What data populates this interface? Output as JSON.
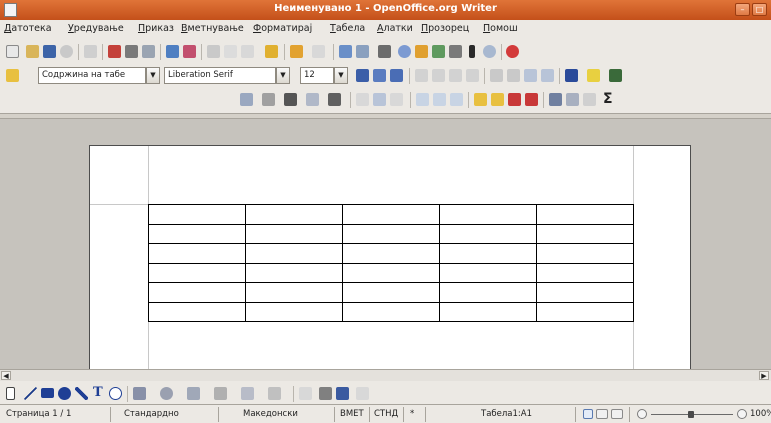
{
  "window": {
    "title": "Неименувано 1 - OpenOffice.org Writer"
  },
  "menu": {
    "items": [
      {
        "first": "Д",
        "rest": "атотека"
      },
      {
        "first": "У",
        "rest": "редување"
      },
      {
        "first": "П",
        "rest": "риказ"
      },
      {
        "first": "В",
        "rest": "метнување"
      },
      {
        "first": "Ф",
        "rest": "орматирај"
      },
      {
        "first": "Т",
        "rest": "абела"
      },
      {
        "first": "А",
        "rest": "латки"
      },
      {
        "first": "П",
        "rest": "розорец"
      },
      {
        "first": "П",
        "rest": "омош"
      }
    ]
  },
  "formatting": {
    "paragraph_style": "Содржина на табе",
    "font_name": "Liberation Serif",
    "font_size": "12"
  },
  "table_toolbar": {
    "sum_symbol": "Σ"
  },
  "document": {
    "table": {
      "rows": 6,
      "cols": 5
    }
  },
  "status": {
    "page": "Страница 1 / 1",
    "page_style": "Стандардно",
    "language": "Македонски",
    "insert_mode": "ВМЕТ",
    "selection_mode": "СТНД",
    "modified": "*",
    "cell": "Табела1:A1",
    "zoom": "100%"
  },
  "colors": {
    "titlebar": "#d4622a",
    "desktop": "#c6c3bd",
    "page": "#ffffff",
    "toolbar": "#ece9e4"
  }
}
